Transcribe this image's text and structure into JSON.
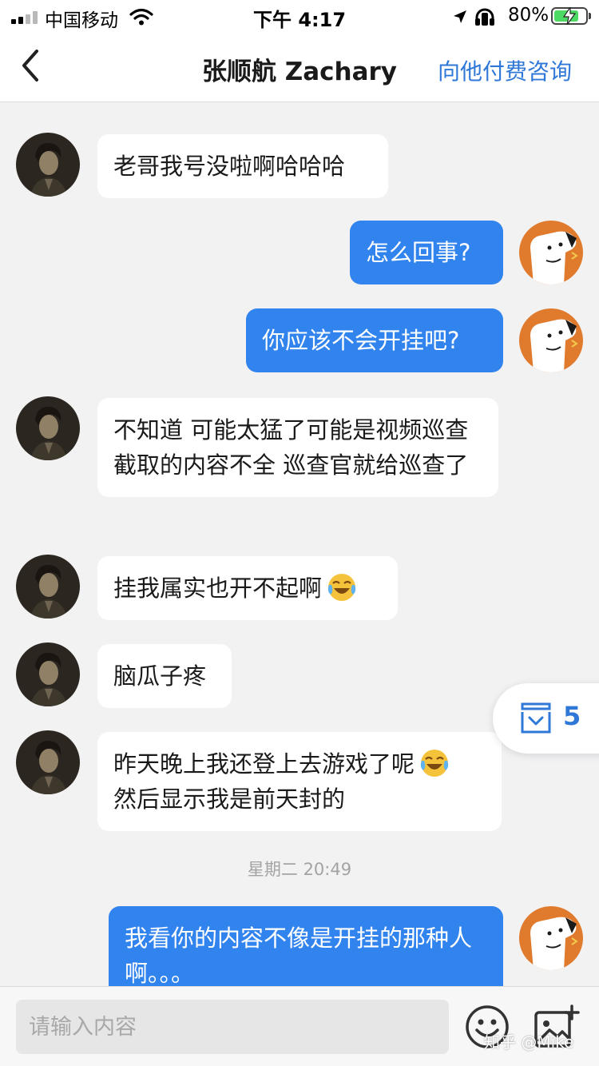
{
  "status_bar": {
    "carrier": "中国移动",
    "time": "下午 4:17",
    "battery_percent": "80%",
    "battery_level": 0.8,
    "icons": [
      "signal-icon",
      "wifi-icon",
      "location-icon",
      "headphones-icon",
      "battery-icon"
    ]
  },
  "header": {
    "title": "张顺航 Zachary",
    "action": "向他付费咨询",
    "back_icon": "chevron-left-icon"
  },
  "messages": [
    {
      "side": "left",
      "text": "老哥我号没啦啊哈哈哈"
    },
    {
      "side": "right",
      "text": "怎么回事?"
    },
    {
      "side": "right",
      "text": "你应该不会开挂吧?"
    },
    {
      "side": "left",
      "text": "不知道 可能太猛了可能是视频巡查截取的内容不全 巡查官就给巡查了"
    },
    {
      "side": "left",
      "text": "挂我属实也开不起啊",
      "emoji": "laughing-crying-emoji"
    },
    {
      "side": "left",
      "text": "脑瓜子疼"
    },
    {
      "side": "left",
      "text_line1": "昨天晚上我还登上去游戏了呢",
      "text_line2": "然后显示我是前天封的",
      "emoji": "laughing-crying-emoji"
    },
    {
      "side": "right",
      "text": "我看你的内容不像是开挂的那种人啊。。。"
    }
  ],
  "timestamp": "星期二 20:49",
  "floating_badge": {
    "count": "5",
    "icon": "inbox-icon"
  },
  "input_bar": {
    "placeholder": "请输入内容",
    "emoji_icon": "smiley-icon",
    "image_icon": "add-image-icon"
  },
  "watermark": "知乎 @Mike",
  "colors": {
    "accent": "#2f78d8",
    "bubble_right": "#3183ee",
    "bubble_left": "#ffffff",
    "background": "#f2f2f3"
  }
}
